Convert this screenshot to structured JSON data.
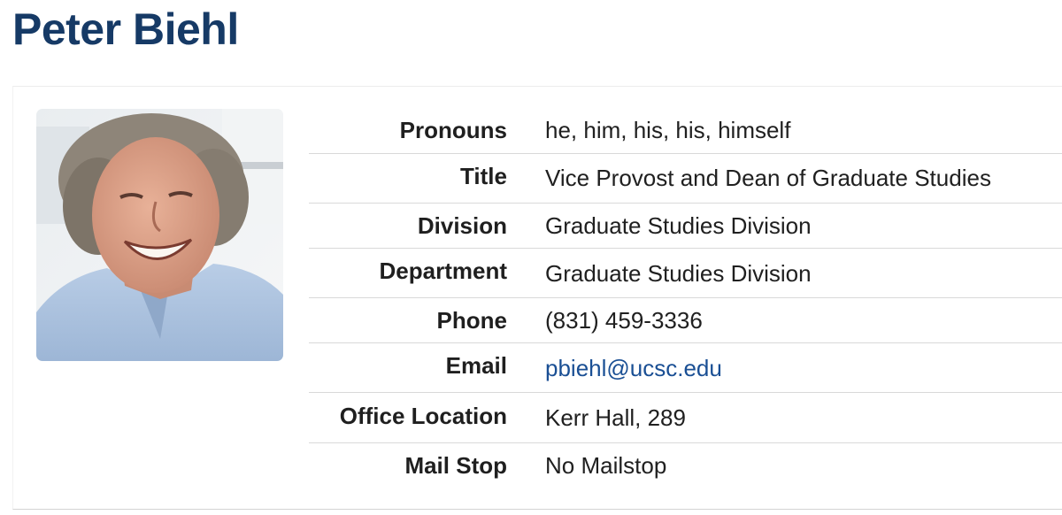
{
  "person": {
    "name": "Peter Biehl"
  },
  "photo": {
    "icon": "profile-photo"
  },
  "details": [
    {
      "label": "Pronouns",
      "value": "he, him, his, his, himself"
    },
    {
      "label": "Title",
      "value": "Vice Provost and Dean of Graduate Studies"
    },
    {
      "label": "Division",
      "value": "Graduate Studies Division"
    },
    {
      "label": "Department",
      "value": "Graduate Studies Division"
    },
    {
      "label": "Phone",
      "value": "(831) 459-3336"
    },
    {
      "label": "Email",
      "value": "pbiehl@ucsc.edu"
    },
    {
      "label": "Office Location",
      "value": "Kerr Hall, 289"
    },
    {
      "label": "Mail Stop",
      "value": "No Mailstop"
    }
  ],
  "colors": {
    "title": "#163a66",
    "link": "#1a4f94",
    "divider": "#d9d9d9"
  }
}
